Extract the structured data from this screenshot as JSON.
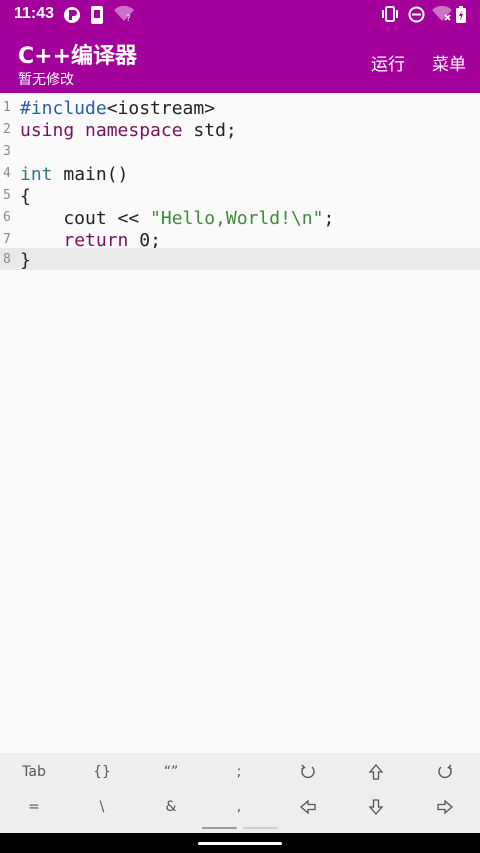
{
  "status_bar": {
    "time": "11:43",
    "left_icons": [
      "notification-app-icon",
      "device-icon",
      "wifi-unknown-icon"
    ],
    "right_icons": [
      "vibrate-icon",
      "do-not-disturb-icon",
      "wifi-off-icon",
      "battery-icon"
    ]
  },
  "app_bar": {
    "title": "C++编译器",
    "subtitle": "暂无修改",
    "actions": [
      {
        "name": "run-button",
        "label": "运行"
      },
      {
        "name": "menu-button",
        "label": "菜单"
      }
    ]
  },
  "editor": {
    "current_line": 8,
    "lines": [
      {
        "num": "1",
        "text": "#include<iostream>"
      },
      {
        "num": "2",
        "text": "using namespace std;"
      },
      {
        "num": "3",
        "text": ""
      },
      {
        "num": "4",
        "text": "int main()"
      },
      {
        "num": "5",
        "text": "{"
      },
      {
        "num": "6",
        "text": "    cout << \"Hello,World!\\n\";"
      },
      {
        "num": "7",
        "text": "    return 0;"
      },
      {
        "num": "8",
        "text": "}"
      }
    ]
  },
  "keybar": {
    "row1": [
      {
        "name": "tab-key",
        "label": "Tab"
      },
      {
        "name": "braces-key",
        "label": "{}"
      },
      {
        "name": "quotes-key",
        "label": "“”"
      },
      {
        "name": "semicolon-key",
        "label": ";"
      },
      {
        "name": "undo-key",
        "icon": "undo-icon"
      },
      {
        "name": "arrow-up-key",
        "icon": "arrow-up-icon"
      },
      {
        "name": "redo-key",
        "icon": "redo-icon"
      }
    ],
    "row2": [
      {
        "name": "equals-key",
        "label": "="
      },
      {
        "name": "backslash-key",
        "label": "\\"
      },
      {
        "name": "ampersand-key",
        "label": "&"
      },
      {
        "name": "comma-key",
        "label": ","
      },
      {
        "name": "arrow-left-key",
        "icon": "arrow-left-icon"
      },
      {
        "name": "arrow-down-key",
        "icon": "arrow-down-icon"
      },
      {
        "name": "arrow-right-key",
        "icon": "arrow-right-icon"
      }
    ]
  },
  "colors": {
    "accent": "#a3009b",
    "keyword": "#7b0f61",
    "preprocessor": "#2b5ca8",
    "type": "#2c7a86",
    "string": "#3d8b35"
  }
}
